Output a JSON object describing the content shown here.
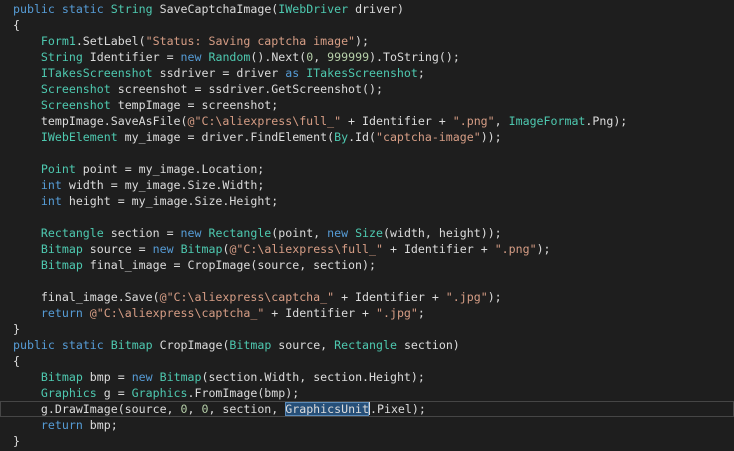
{
  "theme": {
    "background": "#1e1e1e",
    "plain": "#dcdcdc",
    "keyword": "#569cd6",
    "type": "#4ec9b0",
    "string": "#d69d85",
    "number": "#b5cea8",
    "selection": "#264f78"
  },
  "current_line_index": 25,
  "lines": [
    [
      [
        "kw",
        "public"
      ],
      [
        "pl",
        " "
      ],
      [
        "kw",
        "static"
      ],
      [
        "pl",
        " "
      ],
      [
        "ty",
        "String"
      ],
      [
        "pl",
        " SaveCaptchaImage("
      ],
      [
        "ty",
        "IWebDriver"
      ],
      [
        "pl",
        " driver)"
      ]
    ],
    [
      [
        "pl",
        "{"
      ]
    ],
    [
      [
        "pl",
        "    "
      ],
      [
        "ty",
        "Form1"
      ],
      [
        "pl",
        ".SetLabel("
      ],
      [
        "st",
        "\"Status: Saving captcha image\""
      ],
      [
        "pl",
        ");"
      ]
    ],
    [
      [
        "pl",
        "    "
      ],
      [
        "ty",
        "String"
      ],
      [
        "pl",
        " Identifier = "
      ],
      [
        "kw",
        "new"
      ],
      [
        "pl",
        " "
      ],
      [
        "ty",
        "Random"
      ],
      [
        "pl",
        "().Next("
      ],
      [
        "nu",
        "0"
      ],
      [
        "pl",
        ", "
      ],
      [
        "nu",
        "999999"
      ],
      [
        "pl",
        ").ToString();"
      ]
    ],
    [
      [
        "pl",
        "    "
      ],
      [
        "ty",
        "ITakesScreenshot"
      ],
      [
        "pl",
        " ssdriver = driver "
      ],
      [
        "kw",
        "as"
      ],
      [
        "pl",
        " "
      ],
      [
        "ty",
        "ITakesScreenshot"
      ],
      [
        "pl",
        ";"
      ]
    ],
    [
      [
        "pl",
        "    "
      ],
      [
        "ty",
        "Screenshot"
      ],
      [
        "pl",
        " screenshot = ssdriver.GetScreenshot();"
      ]
    ],
    [
      [
        "pl",
        "    "
      ],
      [
        "ty",
        "Screenshot"
      ],
      [
        "pl",
        " tempImage = screenshot;"
      ]
    ],
    [
      [
        "pl",
        "    tempImage.SaveAsFile("
      ],
      [
        "st",
        "@\"C:\\aliexpress\\full_\""
      ],
      [
        "pl",
        " + Identifier + "
      ],
      [
        "st",
        "\".png\""
      ],
      [
        "pl",
        ", "
      ],
      [
        "ty",
        "ImageFormat"
      ],
      [
        "pl",
        ".Png);"
      ]
    ],
    [
      [
        "pl",
        "    "
      ],
      [
        "ty",
        "IWebElement"
      ],
      [
        "pl",
        " my_image = driver.FindElement("
      ],
      [
        "ty",
        "By"
      ],
      [
        "pl",
        ".Id("
      ],
      [
        "st",
        "\"captcha-image\""
      ],
      [
        "pl",
        "));"
      ]
    ],
    [],
    [
      [
        "pl",
        "    "
      ],
      [
        "ty",
        "Point"
      ],
      [
        "pl",
        " point = my_image.Location;"
      ]
    ],
    [
      [
        "pl",
        "    "
      ],
      [
        "kw",
        "int"
      ],
      [
        "pl",
        " width = my_image.Size.Width;"
      ]
    ],
    [
      [
        "pl",
        "    "
      ],
      [
        "kw",
        "int"
      ],
      [
        "pl",
        " height = my_image.Size.Height;"
      ]
    ],
    [],
    [
      [
        "pl",
        "    "
      ],
      [
        "ty",
        "Rectangle"
      ],
      [
        "pl",
        " section = "
      ],
      [
        "kw",
        "new"
      ],
      [
        "pl",
        " "
      ],
      [
        "ty",
        "Rectangle"
      ],
      [
        "pl",
        "(point, "
      ],
      [
        "kw",
        "new"
      ],
      [
        "pl",
        " "
      ],
      [
        "ty",
        "Size"
      ],
      [
        "pl",
        "(width, height));"
      ]
    ],
    [
      [
        "pl",
        "    "
      ],
      [
        "ty",
        "Bitmap"
      ],
      [
        "pl",
        " source = "
      ],
      [
        "kw",
        "new"
      ],
      [
        "pl",
        " "
      ],
      [
        "ty",
        "Bitmap"
      ],
      [
        "pl",
        "("
      ],
      [
        "st",
        "@\"C:\\aliexpress\\full_\""
      ],
      [
        "pl",
        " + Identifier + "
      ],
      [
        "st",
        "\".png\""
      ],
      [
        "pl",
        ");"
      ]
    ],
    [
      [
        "pl",
        "    "
      ],
      [
        "ty",
        "Bitmap"
      ],
      [
        "pl",
        " final_image = CropImage(source, section);"
      ]
    ],
    [],
    [
      [
        "pl",
        "    final_image.Save("
      ],
      [
        "st",
        "@\"C:\\aliexpress\\captcha_\""
      ],
      [
        "pl",
        " + Identifier + "
      ],
      [
        "st",
        "\".jpg\""
      ],
      [
        "pl",
        ");"
      ]
    ],
    [
      [
        "pl",
        "    "
      ],
      [
        "kw",
        "return"
      ],
      [
        "pl",
        " "
      ],
      [
        "st",
        "@\"C:\\aliexpress\\captcha_\""
      ],
      [
        "pl",
        " + Identifier + "
      ],
      [
        "st",
        "\".jpg\""
      ],
      [
        "pl",
        ";"
      ]
    ],
    [
      [
        "pl",
        "}"
      ]
    ],
    [
      [
        "kw",
        "public"
      ],
      [
        "pl",
        " "
      ],
      [
        "kw",
        "static"
      ],
      [
        "pl",
        " "
      ],
      [
        "ty",
        "Bitmap"
      ],
      [
        "pl",
        " CropImage("
      ],
      [
        "ty",
        "Bitmap"
      ],
      [
        "pl",
        " source, "
      ],
      [
        "ty",
        "Rectangle"
      ],
      [
        "pl",
        " section)"
      ]
    ],
    [
      [
        "pl",
        "{"
      ]
    ],
    [
      [
        "pl",
        "    "
      ],
      [
        "ty",
        "Bitmap"
      ],
      [
        "pl",
        " bmp = "
      ],
      [
        "kw",
        "new"
      ],
      [
        "pl",
        " "
      ],
      [
        "ty",
        "Bitmap"
      ],
      [
        "pl",
        "(section.Width, section.Height);"
      ]
    ],
    [
      [
        "pl",
        "    "
      ],
      [
        "ty",
        "Graphics"
      ],
      [
        "pl",
        " g = "
      ],
      [
        "ty",
        "Graphics"
      ],
      [
        "pl",
        ".FromImage(bmp);"
      ]
    ],
    [
      [
        "pl",
        "    g.DrawImage(source, "
      ],
      [
        "nu",
        "0"
      ],
      [
        "pl",
        ", "
      ],
      [
        "nu",
        "0"
      ],
      [
        "pl",
        ", section, "
      ],
      [
        "sel",
        "GraphicsUnit"
      ],
      [
        "caret",
        ""
      ],
      [
        "pl",
        ".Pixel);"
      ]
    ],
    [
      [
        "pl",
        "    "
      ],
      [
        "kw",
        "return"
      ],
      [
        "pl",
        " bmp;"
      ]
    ],
    [
      [
        "pl",
        "}"
      ]
    ]
  ]
}
